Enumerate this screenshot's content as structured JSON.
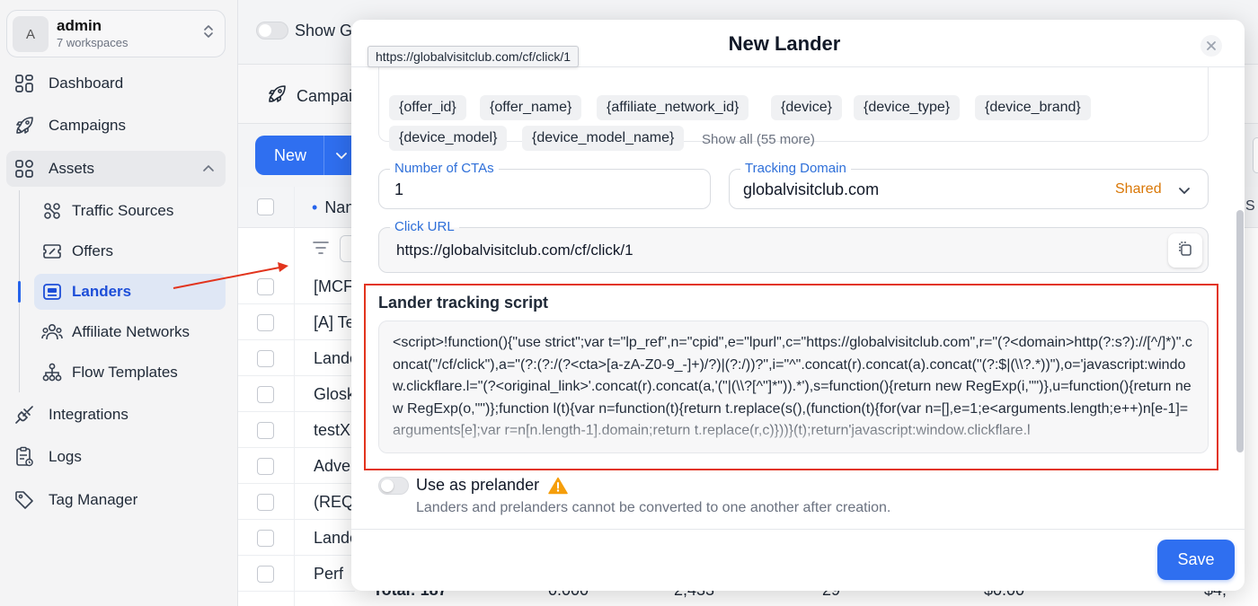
{
  "workspace": {
    "avatar_letter": "A",
    "name": "admin",
    "subtitle": "7 workspaces"
  },
  "sidebar": {
    "items": [
      {
        "label": "Dashboard",
        "icon": "grid-icon"
      },
      {
        "label": "Campaigns",
        "icon": "rocket-icon"
      },
      {
        "label": "Assets",
        "icon": "apps-icon",
        "expanded": true
      },
      {
        "label": "Integrations",
        "icon": "plug-icon"
      },
      {
        "label": "Logs",
        "icon": "clipboard-icon"
      },
      {
        "label": "Tag Manager",
        "icon": "tag-icon"
      }
    ],
    "assets_children": [
      {
        "label": "Traffic Sources",
        "icon": "nodes-icon"
      },
      {
        "label": "Offers",
        "icon": "ticket-icon"
      },
      {
        "label": "Landers",
        "icon": "lander-icon",
        "active": true
      },
      {
        "label": "Affiliate Networks",
        "icon": "users-icon"
      },
      {
        "label": "Flow Templates",
        "icon": "hierarchy-icon"
      }
    ]
  },
  "background": {
    "show_toggle_label": "Show G",
    "tab_label": "Campai",
    "new_button_label": "New",
    "name_header": "Nan",
    "rows": [
      "[MCF",
      "[A] Te",
      "Lande",
      "Glosk",
      "testX",
      "Adver",
      "(REQ",
      "Lande",
      "Perf"
    ],
    "total_row": [
      "Total: 187",
      "0.000",
      "2,433",
      "29",
      "$0.00",
      "$4,"
    ],
    "right_header": "S"
  },
  "modal": {
    "title": "New Lander",
    "tokens_row1": [
      "{offer_id}",
      "{offer_name}",
      "{affiliate_network_id}",
      "{device}",
      "{device_type}",
      "{device_brand}"
    ],
    "tokens_row2": [
      "{device_model}",
      "{device_model_name}"
    ],
    "show_all": "Show all (55 more)",
    "number_of_ctas": {
      "label": "Number of CTAs",
      "value": "1"
    },
    "tracking_domain": {
      "label": "Tracking Domain",
      "value": "globalvisitclub.com",
      "badge": "Shared"
    },
    "click_url": {
      "label": "Click URL",
      "value": "https://globalvisitclub.com/cf/click/1"
    },
    "script_title": "Lander tracking script",
    "script_text": "<script>!function(){\"use strict\";var t=\"lp_ref\",n=\"cpid\",e=\"lpurl\",c=\"https://globalvisitclub.com\",r=\"(?<domain>http(?:s?)://[^/]*)\".concat(\"/cf/click\"),a=\"(?:(?:/(?<cta>[a-zA-Z0-9_-]+)/?)|(?:/))?\",i=\"^\".concat(r).concat(a).concat(\"(?:$|(\\\\?.*))\"),o='javascript:window.clickflare.l=\"(?<original_link>'.concat(r).concat(a,'(\"|(\\\\?[^\"]*\")).*'),s=function(){return new RegExp(i,\"\")},u=function(){return new RegExp(o,\"\")};function l(t){var n=function(t){return t.replace(s(),(function(t){for(var n=[],e=1;e<arguments.length;e++)n[e-1]=arguments[e];var r=n[n.length-1].domain;return t.replace(r,c)}))}(t);return'javascript:window.clickflare.l",
    "prelander_label": "Use as prelander",
    "prelander_help": "Landers and prelanders cannot be converted to one another after creation.",
    "save_label": "Save"
  },
  "tooltip": "https://globalvisitclub.com/cf/click/1",
  "colors": {
    "accent": "#2f6ff0",
    "annotation_red": "#e2341d",
    "shared_badge": "#d97706",
    "warning": "#f59e0b"
  }
}
